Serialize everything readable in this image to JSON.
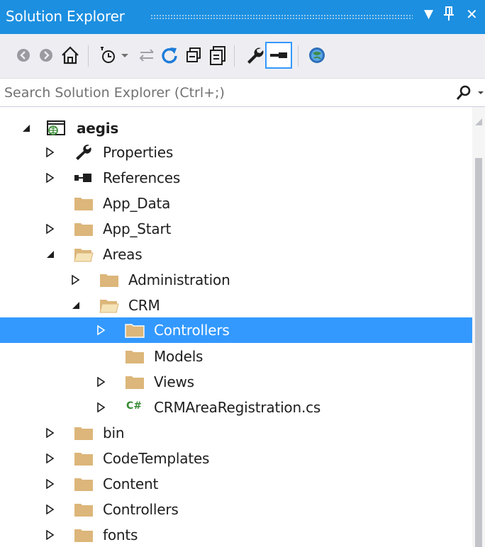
{
  "window": {
    "title": "Solution Explorer",
    "menu_glyph": "▼",
    "pin_glyph": "ᵖ",
    "close_glyph": "✕"
  },
  "toolbar": {
    "icons": [
      "back-icon",
      "forward-icon",
      "home-icon",
      "pending-changes-filter-icon",
      "sync-icon",
      "refresh-icon",
      "collapse-all-icon",
      "show-all-files-icon",
      "properties-icon",
      "preview-selected-icon",
      "view-in-browser-icon"
    ]
  },
  "search": {
    "placeholder": "Search Solution Explorer (Ctrl+;)"
  },
  "tree": {
    "items": [
      {
        "label": "aegis",
        "icon": "web-project-icon",
        "expanded": true
      },
      {
        "label": "Properties",
        "icon": "wrench-icon",
        "expanded": false
      },
      {
        "label": "References",
        "icon": "references-icon",
        "expanded": false
      },
      {
        "label": "App_Data",
        "icon": "folder-icon"
      },
      {
        "label": "App_Start",
        "icon": "folder-icon",
        "expanded": false
      },
      {
        "label": "Areas",
        "icon": "folder-open-icon",
        "expanded": true
      },
      {
        "label": "Administration",
        "icon": "folder-icon",
        "expanded": false
      },
      {
        "label": "CRM",
        "icon": "folder-open-icon",
        "expanded": true
      },
      {
        "label": "Controllers",
        "icon": "folder-icon",
        "expanded": false,
        "selected": true
      },
      {
        "label": "Models",
        "icon": "folder-icon"
      },
      {
        "label": "Views",
        "icon": "folder-icon",
        "expanded": false
      },
      {
        "label": "CRMAreaRegistration.cs",
        "icon": "csharp-file-icon",
        "expanded": false
      },
      {
        "label": "bin",
        "icon": "folder-icon",
        "expanded": false
      },
      {
        "label": "CodeTemplates",
        "icon": "folder-icon",
        "expanded": false
      },
      {
        "label": "Content",
        "icon": "folder-icon",
        "expanded": false
      },
      {
        "label": "Controllers",
        "icon": "folder-icon",
        "expanded": false
      },
      {
        "label": "fonts",
        "icon": "folder-icon",
        "expanded": false
      }
    ]
  },
  "csharp_badge": "C#",
  "colors": {
    "titlebar": "#1c8fe0",
    "selection": "#3399ff",
    "folder": "#dcb67a",
    "toolbar_bg": "#eeeef2"
  }
}
